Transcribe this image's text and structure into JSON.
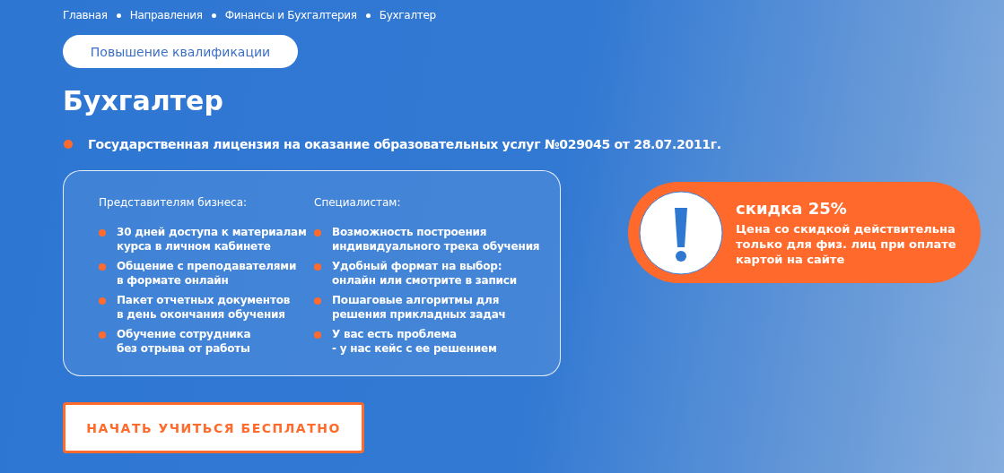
{
  "breadcrumbs": [
    {
      "label": "Главная"
    },
    {
      "label": "Направления"
    },
    {
      "label": "Финансы и Бухгалтерия"
    },
    {
      "label": "Бухгалтер"
    }
  ],
  "category_badge": "Повышение квалификации",
  "title": "Бухгалтер",
  "license": "Государственная лицензия на оказание образовательных услуг №029045 от 28.07.2011г.",
  "benefits": [
    {
      "heading": "Представителям бизнеса:",
      "items": [
        "30 дней доступа к материалам\nкурса в личном кабинете",
        "Общение с преподавателями\nв формате онлайн",
        "Пакет отчетных документов\nв день окончания обучения",
        "Обучение сотрудника\nбез отрыва от работы"
      ]
    },
    {
      "heading": "Специалистам:",
      "items": [
        "Возможность построения\nиндивидуального трека обучения",
        "Удобный формат на выбор:\nонлайн или смотрите в записи",
        "Пошаговые алгоритмы для\nрешения прикладных задач",
        "У вас есть проблема\n- у нас кейс с ее решением"
      ]
    }
  ],
  "promo": {
    "title": "скидка 25%",
    "text": "Цена со скидкой действительна\nтолько для физ. лиц при оплате\nкартой на сайте"
  },
  "cta_button": "НАЧАТЬ УЧИТЬСЯ БЕСПЛАТНО"
}
